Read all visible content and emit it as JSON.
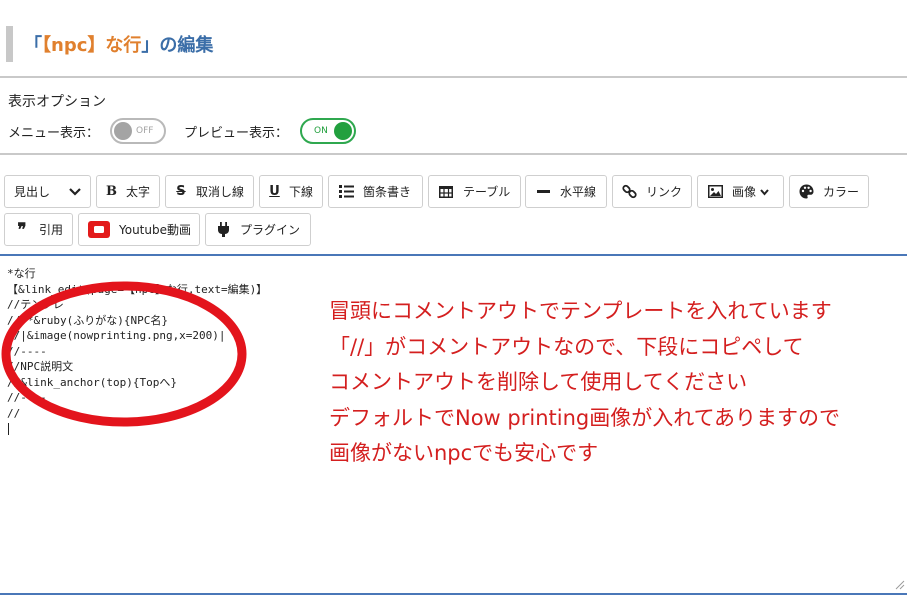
{
  "page": {
    "title_open": "「",
    "title_accent": "【npc】な行",
    "title_close": "」の編集"
  },
  "options": {
    "heading": "表示オプション",
    "menu_label": "メニュー表示：",
    "menu_toggle": "OFF",
    "preview_label": "プレビュー表示：",
    "preview_toggle": "ON"
  },
  "toolbar": {
    "heading_select": "見出し",
    "bold": "太字",
    "strike": "取消し線",
    "underline": "下線",
    "list": "箇条書き",
    "table": "テーブル",
    "hr": "水平線",
    "link": "リンク",
    "image": "画像",
    "color": "カラー",
    "quote": "引用",
    "youtube": "Youtube動画",
    "plugin": "プラグイン"
  },
  "editor": {
    "lines": [
      "*な行",
      "【&link_edit(page=【npc】な行,text=編集)】",
      "//テンプレ",
      "//**&ruby(ふりがな){NPC名}",
      "//|&image(nowprinting.png,x=200)|",
      "//----",
      "//NPC説明文",
      "//&link_anchor(top){Topへ}",
      "//----",
      "//"
    ]
  },
  "annotation": {
    "lines": [
      "冒頭にコメントアウトでテンプレートを入れています",
      "「//」がコメントアウトなので、下段にコピペして",
      "コメントアウトを削除して使用してください",
      "デフォルトでNow printing画像が入れてありますので",
      "画像がないnpcでも安心です"
    ],
    "color": "#d41f1f",
    "circle_color": "#e3141c"
  },
  "colors": {
    "title": "#3b6ea8",
    "title_accent": "#e0802e",
    "toggle_on": "#22a03e",
    "editor_border": "#4a77b8"
  }
}
